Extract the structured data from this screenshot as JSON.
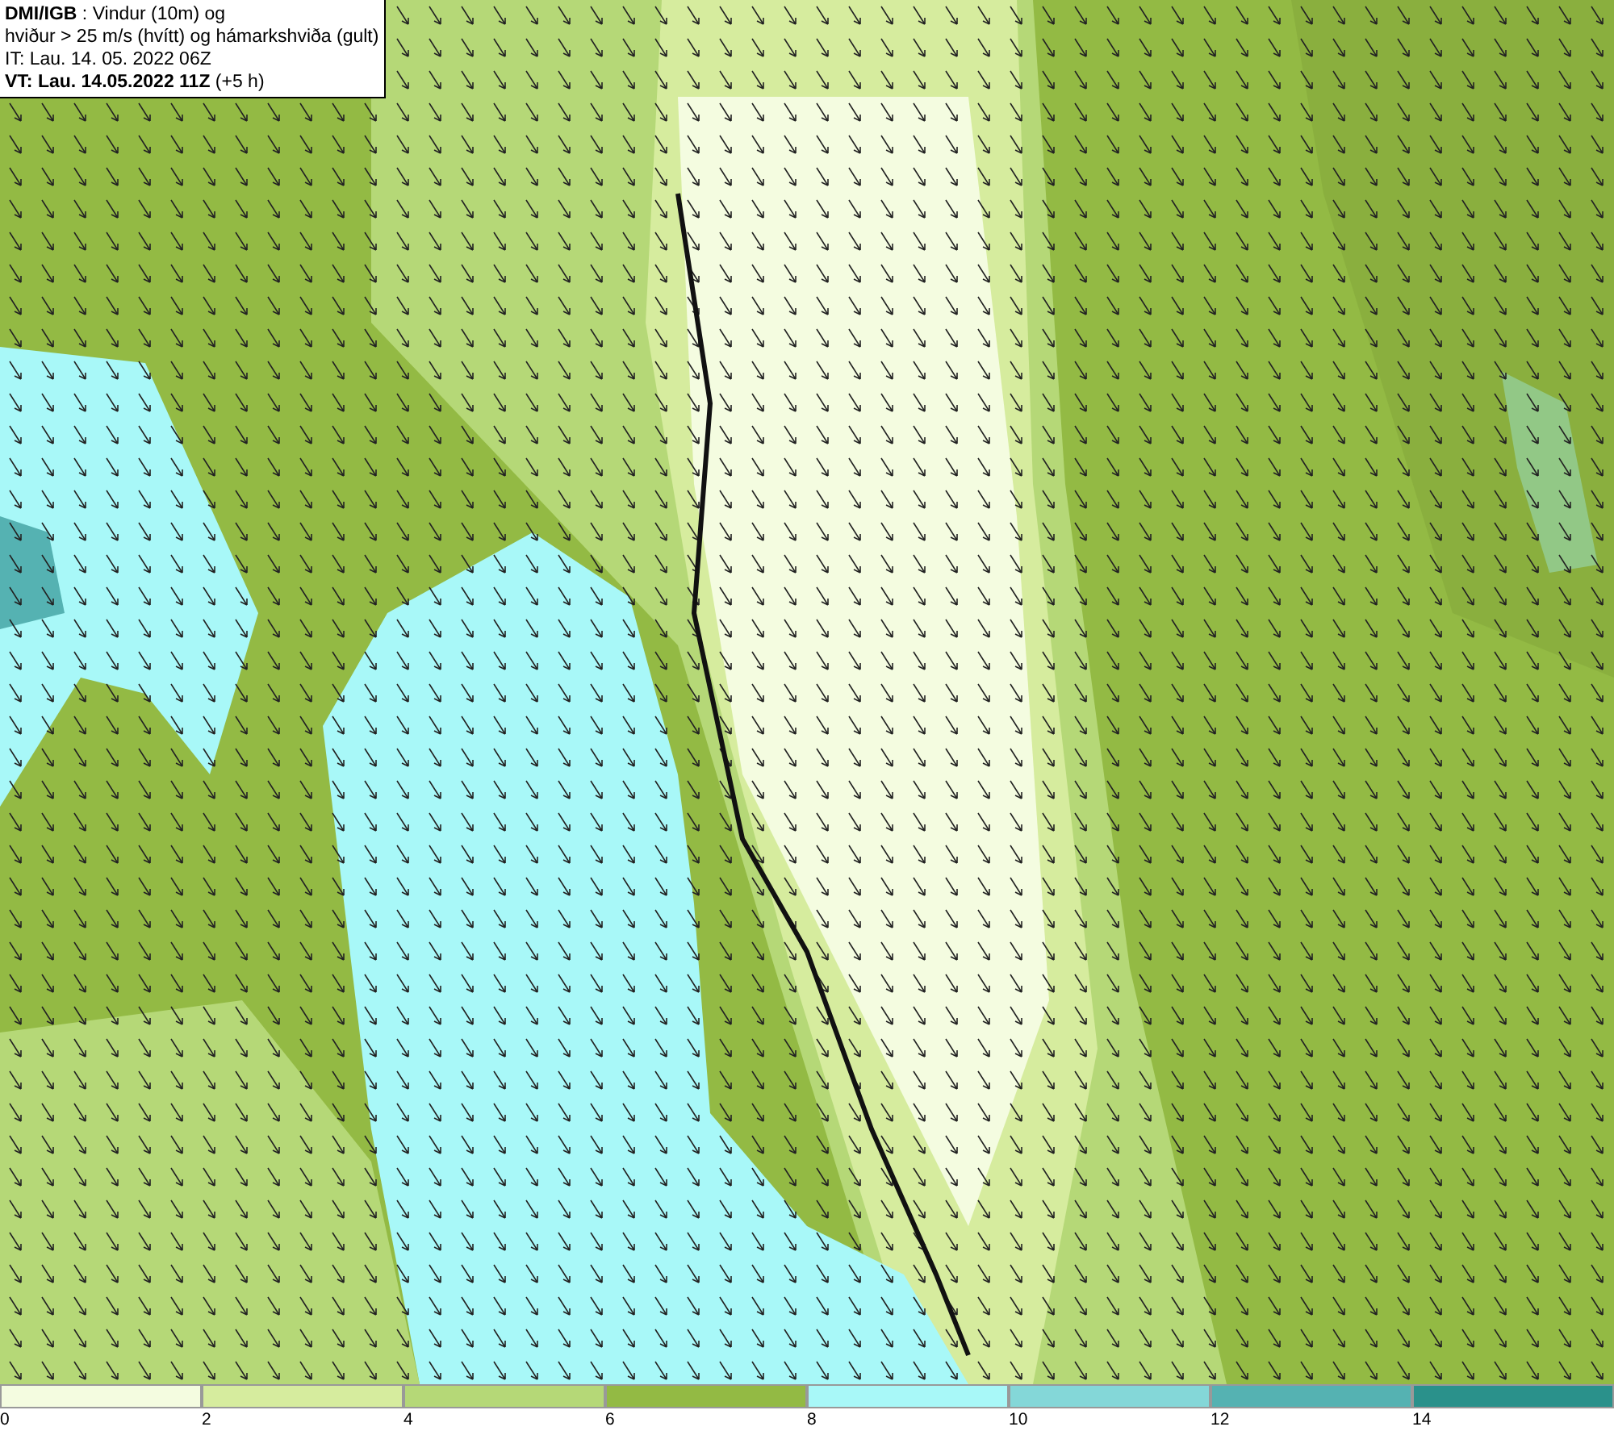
{
  "header": {
    "lines": [
      "**DMI/IGB** : Vindur (10m) og",
      "hviður > 25 m/s (hvítt) og hámarkshviða (gult)",
      "IT: Lau. 14. 05. 2022 06Z",
      "**VT: Lau. 14.05.2022 11Z** (+5 h)"
    ]
  },
  "legend": {
    "bins": [
      {
        "color": "#f4fce0"
      },
      {
        "color": "#d6ec9e"
      },
      {
        "color": "#b5d877"
      },
      {
        "color": "#93ba44"
      },
      {
        "color": "#a8f8f8"
      },
      {
        "color": "#84d7d8"
      },
      {
        "color": "#55b2b2"
      },
      {
        "color": "#2a918b"
      }
    ],
    "ticks": [
      "0",
      "2",
      "4",
      "6",
      "8",
      "10",
      "12",
      "14"
    ]
  }
}
